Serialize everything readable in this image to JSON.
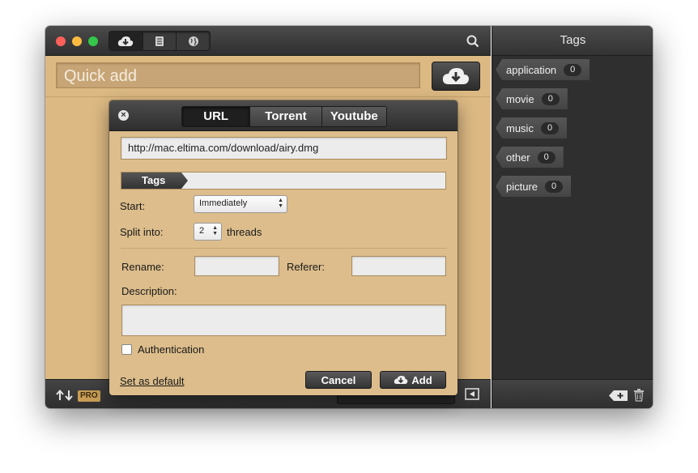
{
  "window": {
    "quick_add_placeholder": "Quick add",
    "toolbar_segments": [
      "cloud-download-icon",
      "list-icon",
      "globe-icon"
    ],
    "pro_badge": "PRO"
  },
  "tags_panel": {
    "title": "Tags",
    "tags": [
      {
        "label": "application",
        "count": "0"
      },
      {
        "label": "movie",
        "count": "0"
      },
      {
        "label": "music",
        "count": "0"
      },
      {
        "label": "other",
        "count": "0"
      },
      {
        "label": "picture",
        "count": "0"
      }
    ]
  },
  "dialog": {
    "tabs": [
      "URL",
      "Torrent",
      "Youtube"
    ],
    "active_tab": "URL",
    "url_value": "http://mac.eltima.com/download/airy.dmg",
    "tags_label": "Tags",
    "start_label": "Start:",
    "start_value": "Immediately",
    "split_label": "Split into:",
    "split_value": "2",
    "threads_label": "threads",
    "rename_label": "Rename:",
    "rename_value": "",
    "referer_label": "Referer:",
    "referer_value": "",
    "description_label": "Description:",
    "description_value": "",
    "auth_label": "Authentication",
    "auth_checked": false,
    "set_default_label": "Set as default",
    "cancel_label": "Cancel",
    "add_label": "Add"
  },
  "colors": {
    "panel_tan": "#dcb983",
    "dark_chrome": "#2f2f2f"
  }
}
